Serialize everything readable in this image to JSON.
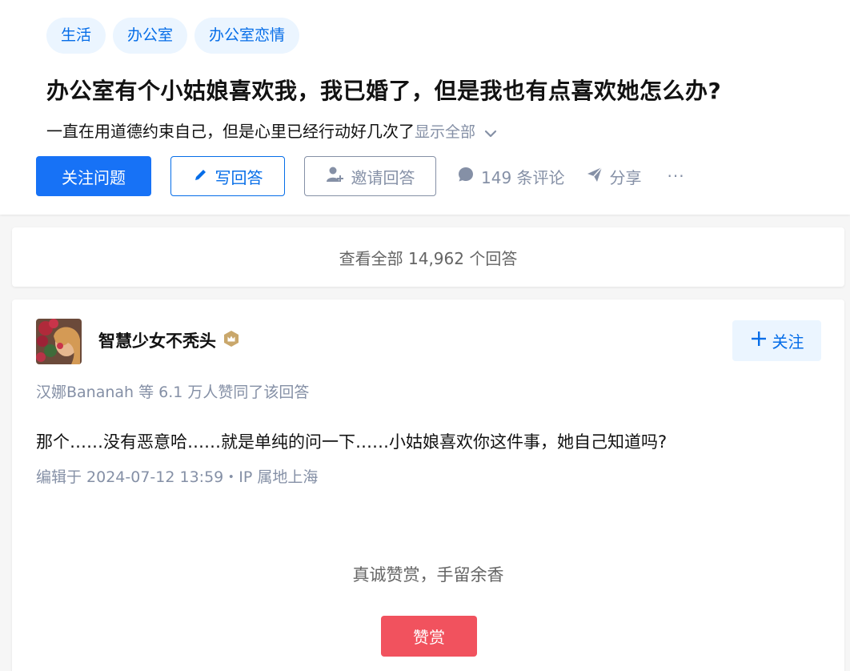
{
  "topics": [
    "生活",
    "办公室",
    "办公室恋情"
  ],
  "question": {
    "title": "办公室有个小姑娘喜欢我，我已婚了，但是我也有点喜欢她怎么办?",
    "description": "一直在用道德约束自己，但是心里已经行动好几次了",
    "show_all": "显示全部"
  },
  "actions": {
    "follow_question": "关注问题",
    "write_answer": "写回答",
    "invite_answer": "邀请回答",
    "comments": "149 条评论",
    "share": "分享",
    "more": "···"
  },
  "view_all_answers": "查看全部 14,962 个回答",
  "answer": {
    "author": "智慧少女不秃头",
    "follow": "关注",
    "voters": "汉娜Bananah 等 6.1 万人赞同了该回答",
    "content": "那个……没有恶意哈……就是单纯的问一下……小姑娘喜欢你这件事，她自己知道吗?",
    "meta": "编辑于 2024-07-12 13:59・IP 属地上海",
    "reward_text": "真诚赞赏，手留余香",
    "reward_button": "赞赏"
  },
  "colors": {
    "brand_blue": "#1772f6",
    "link_blue": "#056de8",
    "topic_bg": "#ebf5ff",
    "muted_text": "#8590a6",
    "reward_red": "#f1525e",
    "badge_gold": "#c9a76b"
  }
}
